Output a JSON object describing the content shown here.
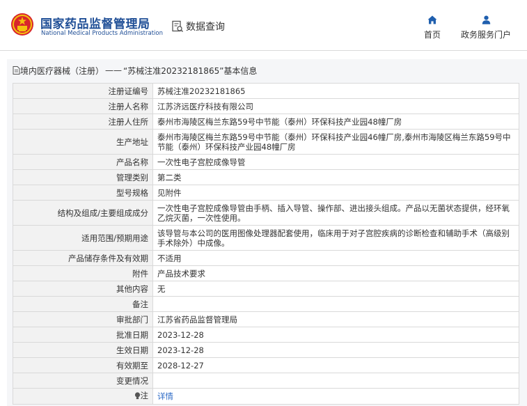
{
  "header": {
    "org_name_cn": "国家药品监督管理局",
    "org_name_en": "National Medical Products Administration",
    "query_label": "数据查询",
    "nav": [
      {
        "label": "首页",
        "icon": "home-icon"
      },
      {
        "label": "政务服务门户",
        "icon": "user-icon"
      }
    ]
  },
  "breadcrumb": {
    "category": "境内医疗器械（注册）",
    "separator": "——",
    "title": "“苏械注准20232181865”基本信息"
  },
  "fields": [
    {
      "key": "注册证编号",
      "value": "苏械注准20232181865"
    },
    {
      "key": "注册人名称",
      "value": "江苏济远医疗科技有限公司"
    },
    {
      "key": "注册人住所",
      "value": "泰州市海陵区梅兰东路59号中节能（泰州）环保科技产业园48幢厂房"
    },
    {
      "key": "生产地址",
      "value": "泰州市海陵区梅兰东路59号中节能（泰州）环保科技产业园46幢厂房,泰州市海陵区梅兰东路59号中节能（泰州）环保科技产业园48幢厂房"
    },
    {
      "key": "产品名称",
      "value": "一次性电子宫腔成像导管"
    },
    {
      "key": "管理类别",
      "value": "第二类"
    },
    {
      "key": "型号规格",
      "value": "见附件"
    },
    {
      "key": "结构及组成/主要组成成分",
      "value": "一次性电子宫腔成像导管由手柄、插入导管、操作部、进出接头组成。产品以无菌状态提供，经环氧乙烷灭菌，一次性使用。"
    },
    {
      "key": "适用范围/预期用途",
      "value": "该导管与本公司的医用图像处理器配套使用，临床用于对子宫腔疾病的诊断检查和辅助手术（高级别手术除外）中成像。"
    },
    {
      "key": "产品储存条件及有效期",
      "value": "不适用"
    },
    {
      "key": "附件",
      "value": "产品技术要求"
    },
    {
      "key": "其他内容",
      "value": "无"
    },
    {
      "key": "备注",
      "value": ""
    },
    {
      "key": "审批部门",
      "value": "江苏省药品监督管理局"
    },
    {
      "key": "批准日期",
      "value": "2023-12-28"
    },
    {
      "key": "生效日期",
      "value": "2023-12-28"
    },
    {
      "key": "有效期至",
      "value": "2028-12-27"
    },
    {
      "key": "变更情况",
      "value": ""
    }
  ],
  "remark": {
    "key": "注",
    "link": "详情",
    "icon": "lightbulb-icon"
  },
  "colors": {
    "brand_blue": "#1f4e96",
    "link_blue": "#2e6bc6",
    "emblem_red": "#d8262b",
    "emblem_gold": "#f4c20d"
  }
}
